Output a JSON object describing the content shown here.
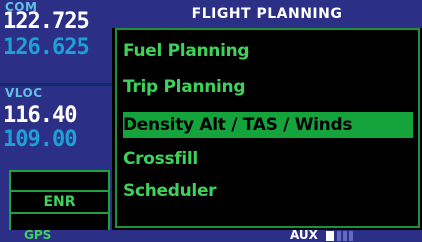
{
  "left_panel": {
    "com_label": "COM",
    "com_active": "122.725",
    "com_standby": "126.625",
    "vloc_label": "VLOC",
    "vloc_active": "116.40",
    "vloc_standby": "109.00",
    "cdi_mode": "ENR"
  },
  "page": {
    "title": "FLIGHT PLANNING",
    "items": [
      {
        "label": "Fuel Planning",
        "selected": false
      },
      {
        "label": "Trip Planning",
        "selected": false
      },
      {
        "label": "Density Alt / TAS / Winds",
        "selected": true
      },
      {
        "label": "Crossfill",
        "selected": false
      },
      {
        "label": "Scheduler",
        "selected": false
      }
    ]
  },
  "status_bar": {
    "mode": "GPS",
    "page_group": "AUX"
  },
  "colors": {
    "bezel_blue": "#2c2f86",
    "text_green": "#3fd25a",
    "select_green": "#14a43b",
    "standby_cyan": "#1e9fd6"
  }
}
